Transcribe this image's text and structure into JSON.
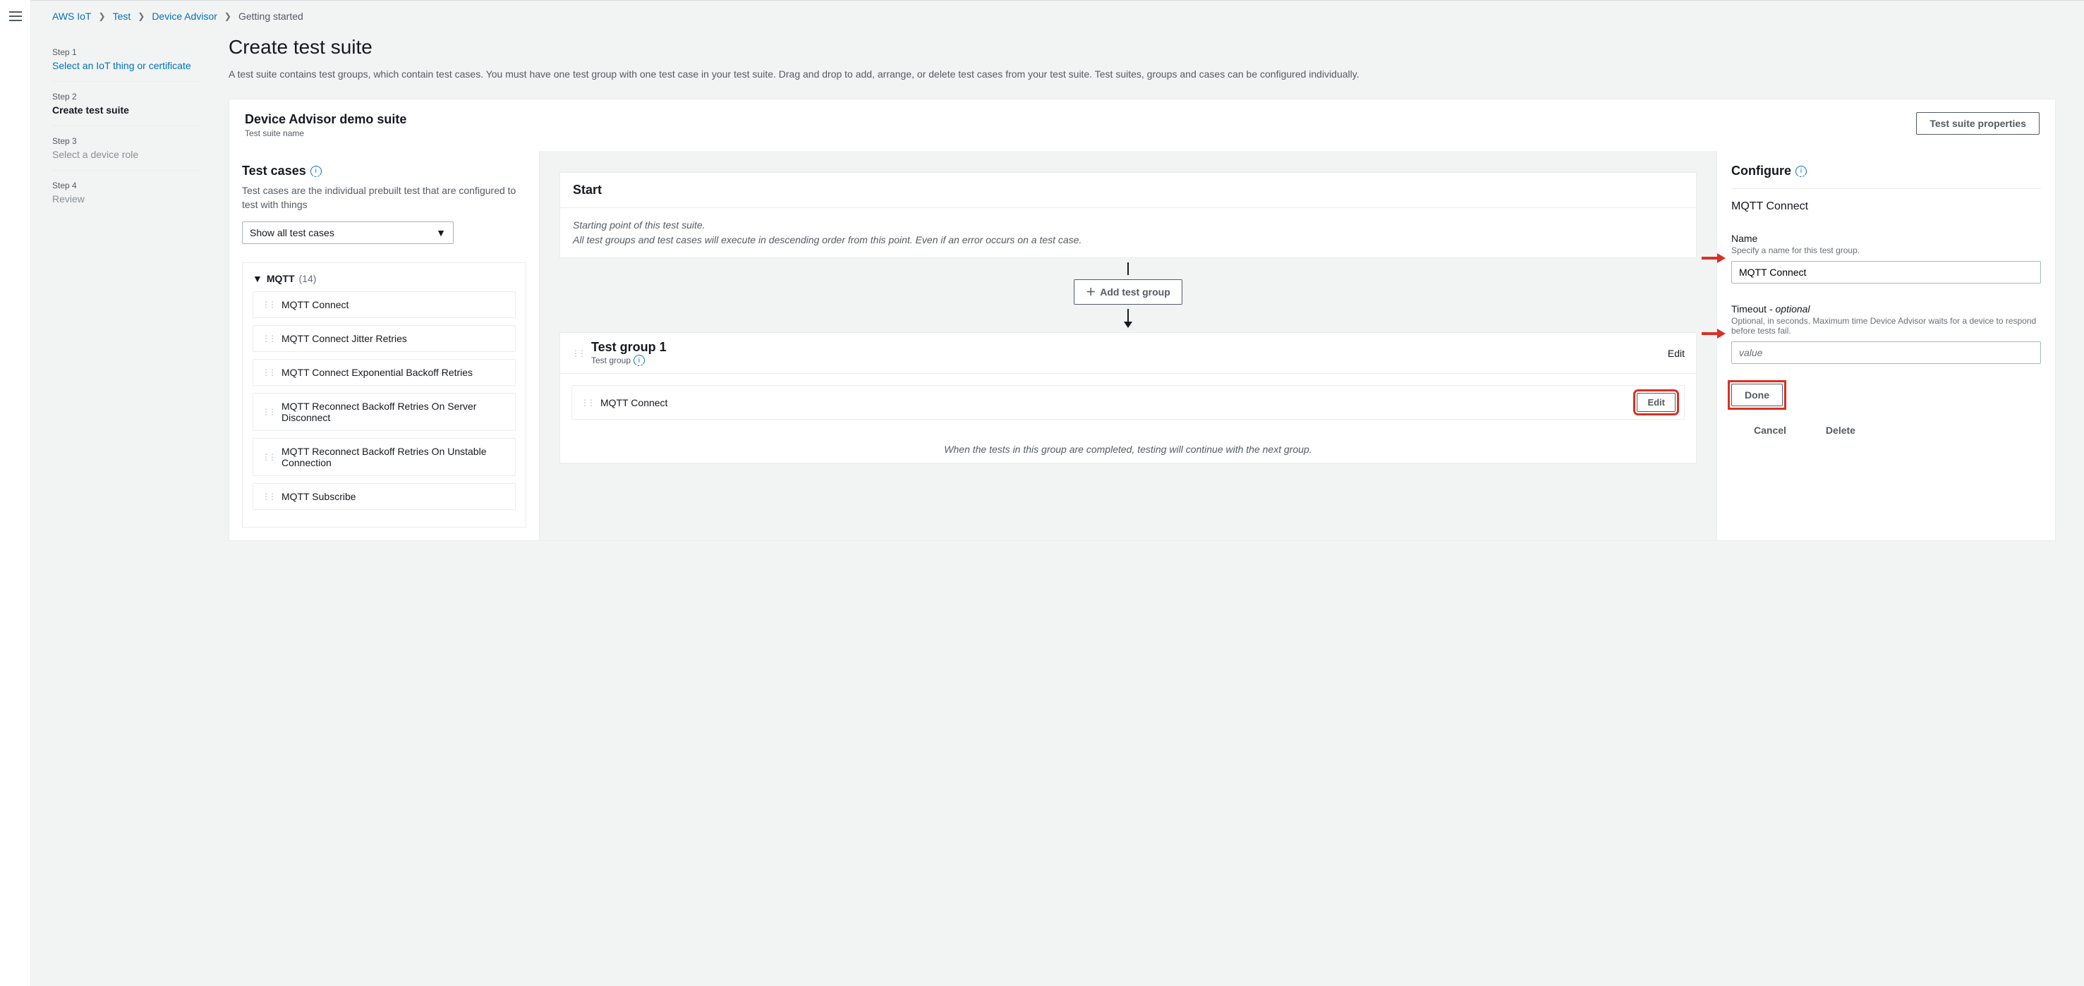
{
  "breadcrumb": {
    "items": [
      "AWS IoT",
      "Test",
      "Device Advisor"
    ],
    "current": "Getting started"
  },
  "wizard": {
    "steps": [
      {
        "label": "Step 1",
        "title": "Select an IoT thing or certificate",
        "state": "link"
      },
      {
        "label": "Step 2",
        "title": "Create test suite",
        "state": "active"
      },
      {
        "label": "Step 3",
        "title": "Select a device role",
        "state": "disabled"
      },
      {
        "label": "Step 4",
        "title": "Review",
        "state": "disabled"
      }
    ]
  },
  "page": {
    "title": "Create test suite",
    "desc": "A test suite contains test groups, which contain test cases. You must have one test group with one test case in your test suite. Drag and drop to add, arrange, or delete test cases from your test suite. Test suites, groups and cases can be configured individually."
  },
  "suite": {
    "title": "Device Advisor demo suite",
    "subtitle": "Test suite name",
    "props_btn": "Test suite properties"
  },
  "testCases": {
    "title": "Test cases",
    "desc": "Test cases are the individual prebuilt test that are configured to test with things",
    "filter": "Show all test cases",
    "category": {
      "name": "MQTT",
      "count": "(14)"
    },
    "items": [
      "MQTT Connect",
      "MQTT Connect Jitter Retries",
      "MQTT Connect Exponential Backoff Retries",
      "MQTT Reconnect Backoff Retries On Server Disconnect",
      "MQTT Reconnect Backoff Retries On Unstable Connection",
      "MQTT Subscribe"
    ]
  },
  "builder": {
    "start_title": "Start",
    "start_line1": "Starting point of this test suite.",
    "start_line2": "All test groups and test cases will execute in descending order from this point. Even if an error occurs on a test case.",
    "add_group": "Add test group",
    "group": {
      "title": "Test group 1",
      "subtitle": "Test group",
      "edit": "Edit",
      "tc": "MQTT Connect",
      "tc_edit": "Edit",
      "footer": "When the tests in this group are completed, testing will continue with the next group."
    }
  },
  "configure": {
    "title": "Configure",
    "subtitle": "MQTT Connect",
    "name_label": "Name",
    "name_hint": "Specify a name for this test group.",
    "name_value": "MQTT Connect",
    "timeout_label": "Timeout - ",
    "timeout_optional": "optional",
    "timeout_hint": "Optional, in seconds. Maximum time Device Advisor waits for a device to respond before tests fail.",
    "timeout_placeholder": "value",
    "done": "Done",
    "cancel": "Cancel",
    "delete": "Delete"
  }
}
